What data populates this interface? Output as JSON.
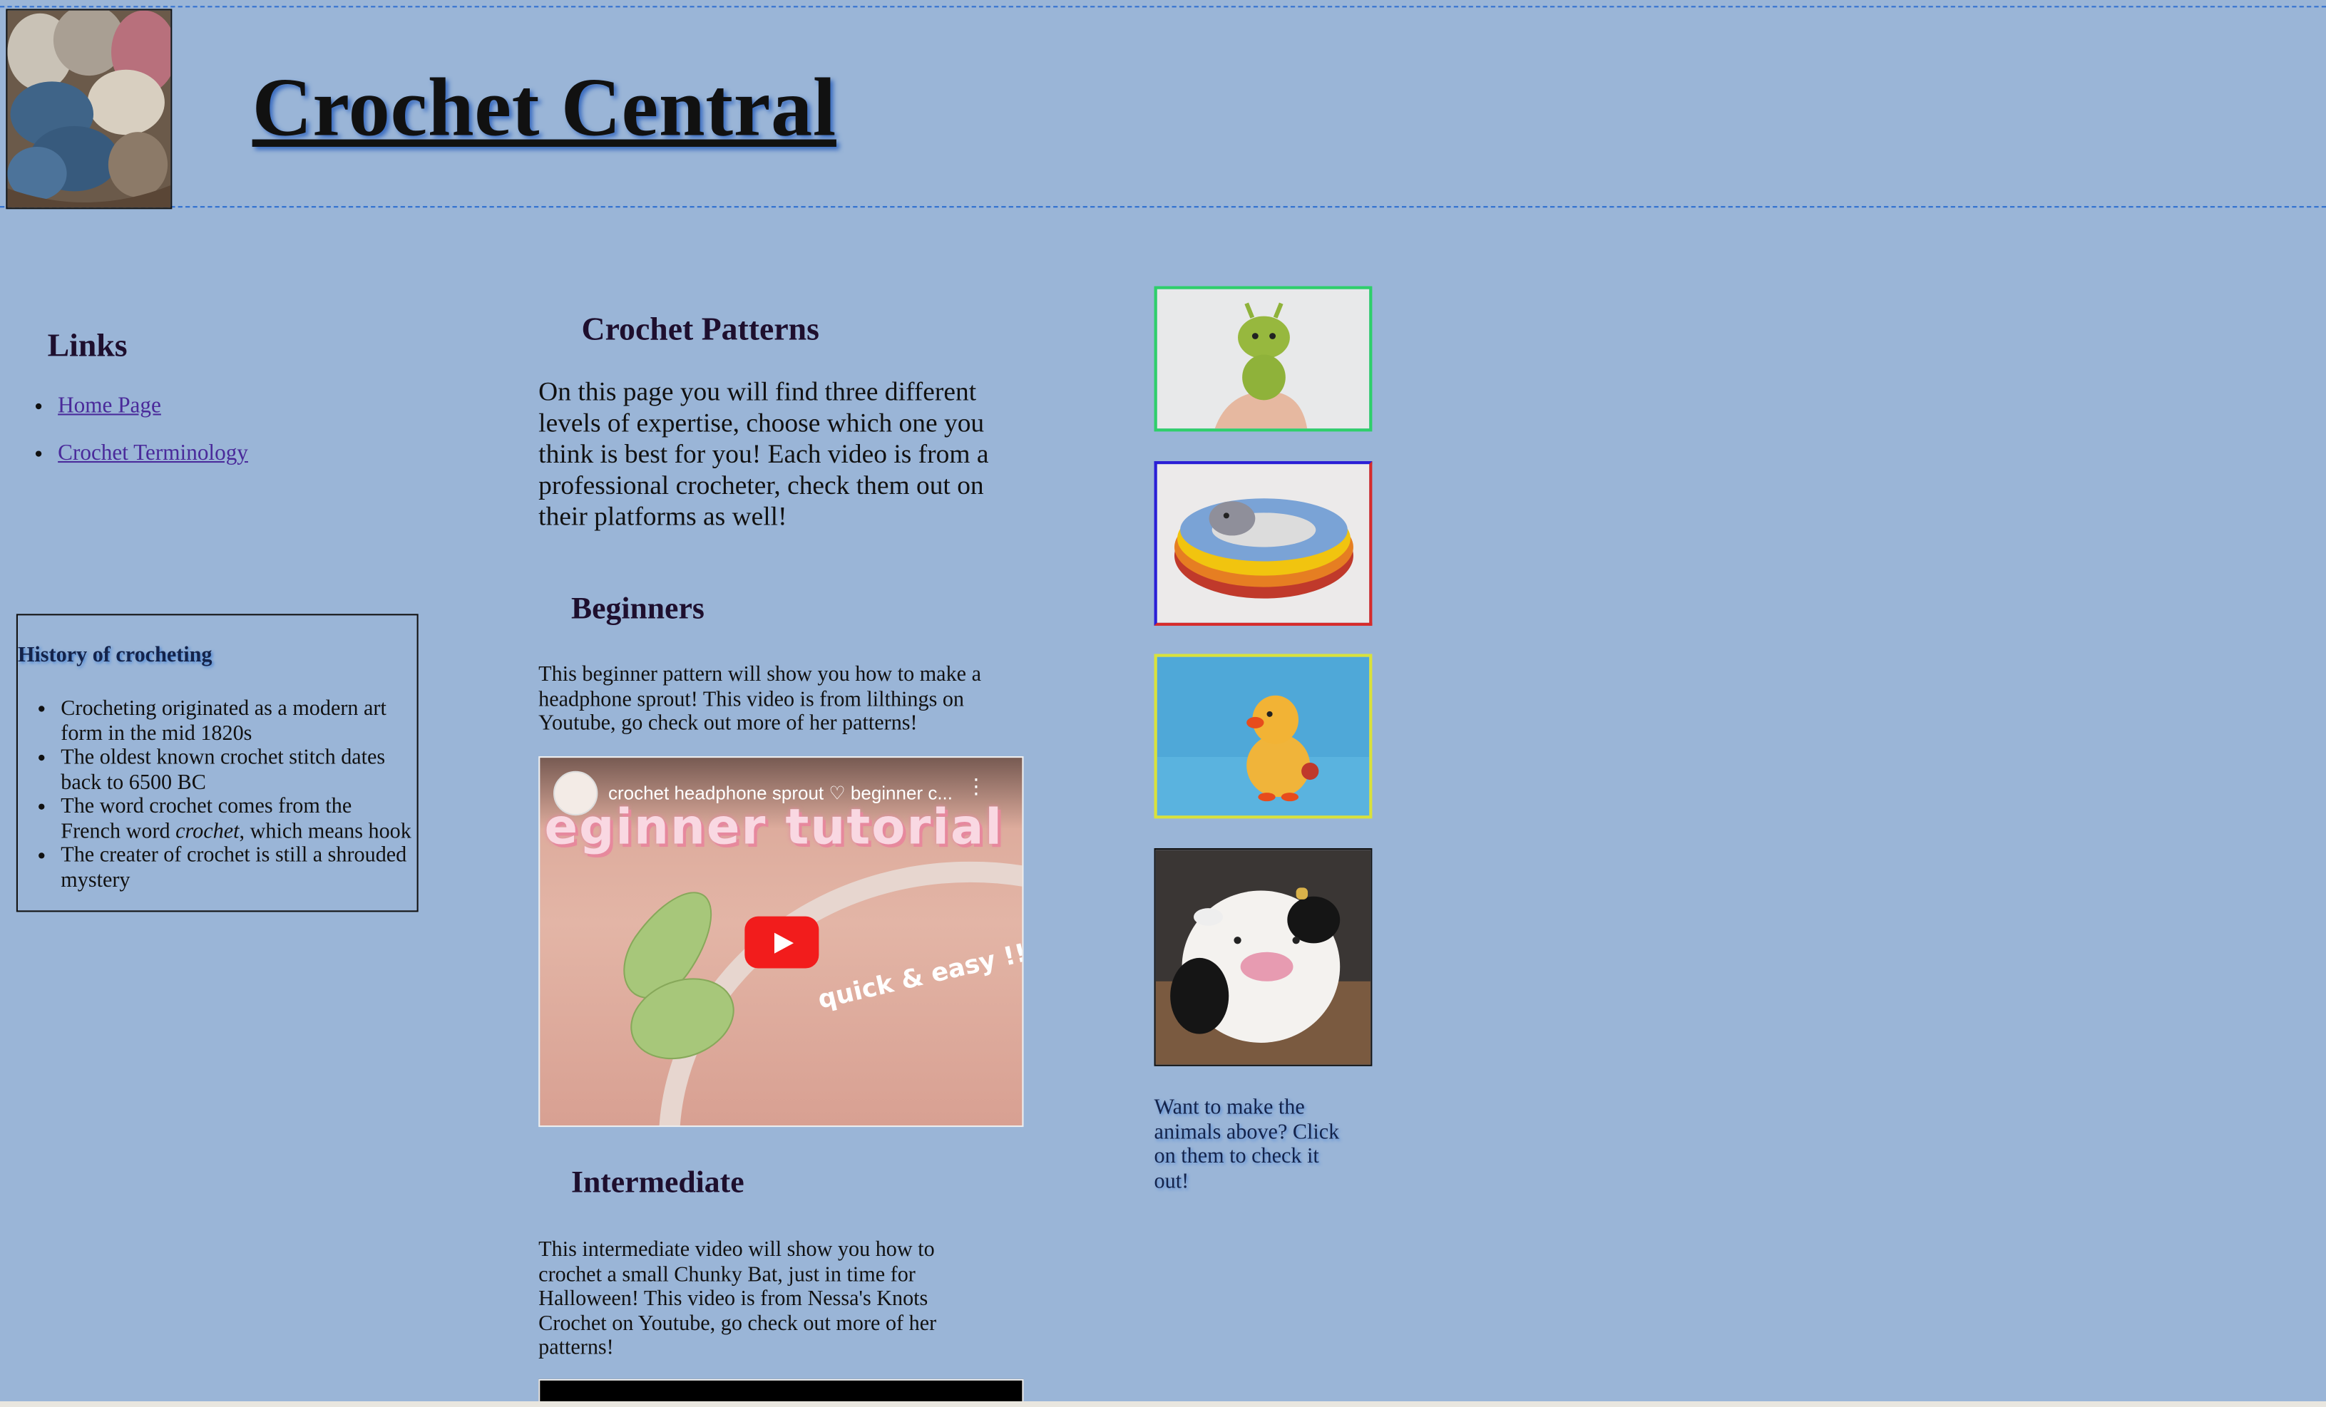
{
  "header": {
    "site_title": "Crochet Central"
  },
  "sidebar": {
    "links_title": "Links",
    "links": [
      {
        "label": "Home Page"
      },
      {
        "label": "Crochet Terminology"
      }
    ],
    "history": {
      "title": "History of crocheting",
      "items": [
        "Crocheting originated as a modern art form in the mid 1820s",
        "The oldest known crochet stitch dates back to 6500 BC",
        {
          "before": "The word crochet comes from the French word ",
          "em": "crochet",
          "after": ", which means hook"
        },
        "The creater of crochet is still a shrouded mystery"
      ]
    }
  },
  "main": {
    "title": "Crochet Patterns",
    "intro": "On this page you will find three different levels of expertise, choose which one you think is best for you! Each video is from a professional crocheter, check them out on their platforms as well!",
    "beginners": {
      "title": "Beginners",
      "text": "This beginner pattern will show you how to make a headphone sprout! This video is from lilthings on Youtube, go check out more of her patterns!",
      "video": {
        "title": "crochet headphone sprout ♡ beginner c...",
        "overlay_big": "eginner tutorial",
        "overlay_small": "quick & easy !!",
        "kebab": "⋮"
      }
    },
    "intermediate": {
      "title": "Intermediate",
      "text": "This intermediate video will show you how to crochet a small Chunky Bat, just in time for Halloween! This video is from Nessa's Knots Crochet on Youtube, go check out more of her patterns!"
    }
  },
  "aside": {
    "animals_text": "Want to make the animals above? Click on them to check it out!",
    "thumbnails": [
      {
        "name": "green-alien-amigurumi",
        "border_color": "#2ecf6a"
      },
      {
        "name": "striped-snake-amigurumi",
        "border_color": "#2b1fd6"
      },
      {
        "name": "yellow-duck-amigurumi",
        "border_color": "#d9e23a"
      },
      {
        "name": "cow-amigurumi",
        "border_color": "#111111"
      }
    ]
  },
  "colors": {
    "background": "#9ab5d7",
    "link": "#4a2a9a",
    "header_dash": "#2f6fd0"
  }
}
